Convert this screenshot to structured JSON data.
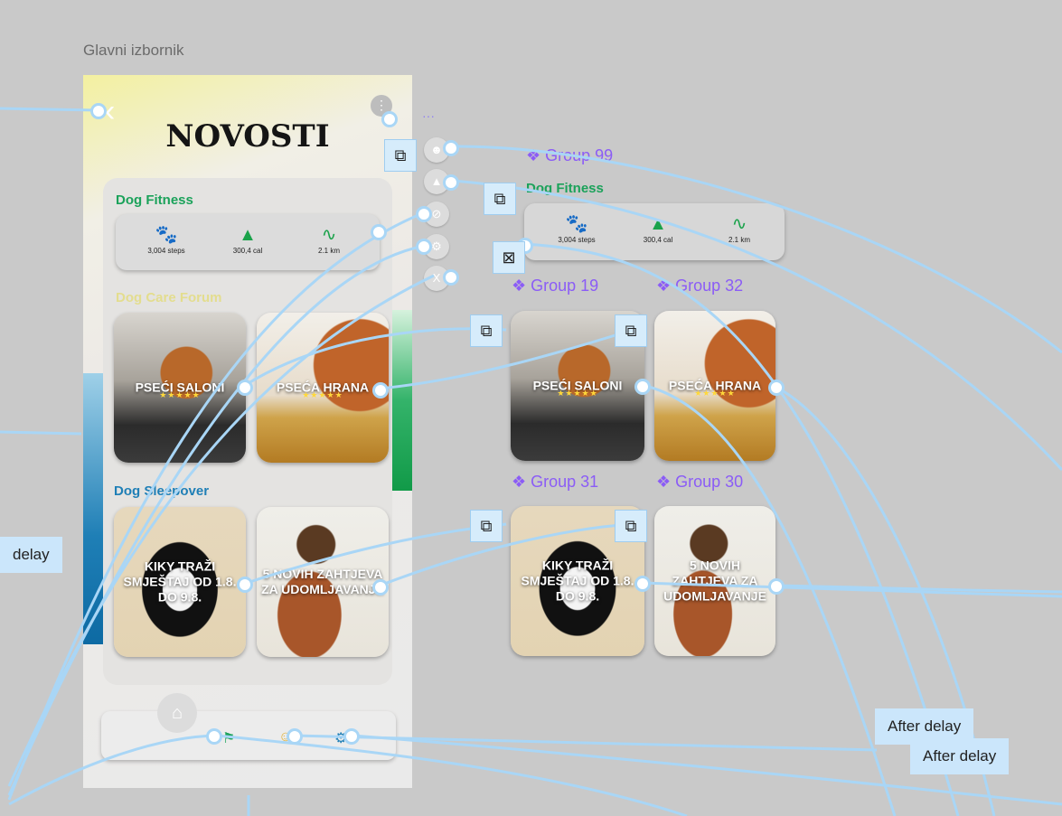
{
  "frame_label": "Glavni izbornik",
  "screen": {
    "title": "NOVOSTI",
    "back_icon": "chevron-left-icon",
    "more_icon": "vertical-dots-icon",
    "fitness": {
      "title": "Dog Fitness",
      "title_color": "#1ba25a",
      "stats": [
        {
          "icon": "paw-icon",
          "value": "3,004 steps"
        },
        {
          "icon": "flame-icon",
          "value": "300,4 cal"
        },
        {
          "icon": "route-icon",
          "value": "2.1 km"
        }
      ]
    },
    "forum": {
      "title": "Dog Care Forum",
      "title_color": "#e3dd8e",
      "tiles": [
        {
          "label": "PSEĆI SALONI",
          "stars": "★★★★★"
        },
        {
          "label": "PSEĆA HRANA",
          "stars": "★★★★★"
        }
      ]
    },
    "sleepover": {
      "title": "Dog Sleepover",
      "title_color": "#1f7fb6",
      "tiles": [
        {
          "label": "KIKY TRAŽI SMJEŠTAJ OD 1.8. DO 9.8."
        },
        {
          "label": "5 NOVIH ZAHTJEVA ZA UDOMLJAVANJE"
        }
      ]
    },
    "bottom_nav": [
      "home-icon",
      "dog-walk-icon",
      "people-icon",
      "settings-icon"
    ]
  },
  "controls": {
    "dots": "···",
    "buttons": [
      "user-icon",
      "fire-icon",
      "forbid-icon",
      "gear-icon",
      "X"
    ]
  },
  "preview": {
    "fitness_title": "Dog Fitness",
    "stats": [
      "3,004 steps",
      "300,4 cal",
      "2.1 km"
    ],
    "groups": [
      "❖ Group 99",
      "❖ Group 19",
      "❖ Group 32",
      "❖ Group 31",
      "❖ Group 30"
    ],
    "tiles": [
      {
        "label": "PSEĆI SALONI",
        "stars": "★★★★★"
      },
      {
        "label": "PSEĆA HRANA",
        "stars": "★★★★★"
      },
      {
        "label": "KIKY TRAŽI SMJEŠTAJ OD 1.8. DO 9.8."
      },
      {
        "label": "5 NOVIH ZAHTJEVA ZA UDOMLJAVANJE"
      }
    ]
  },
  "prototype": {
    "delay_left": "delay",
    "after_delay_1": "After delay",
    "after_delay_2": "After delay",
    "link_icon": "⧉",
    "close_icon": "⊠",
    "wire_color": "#a9d6f6",
    "group_color": "#8b5cf6"
  }
}
